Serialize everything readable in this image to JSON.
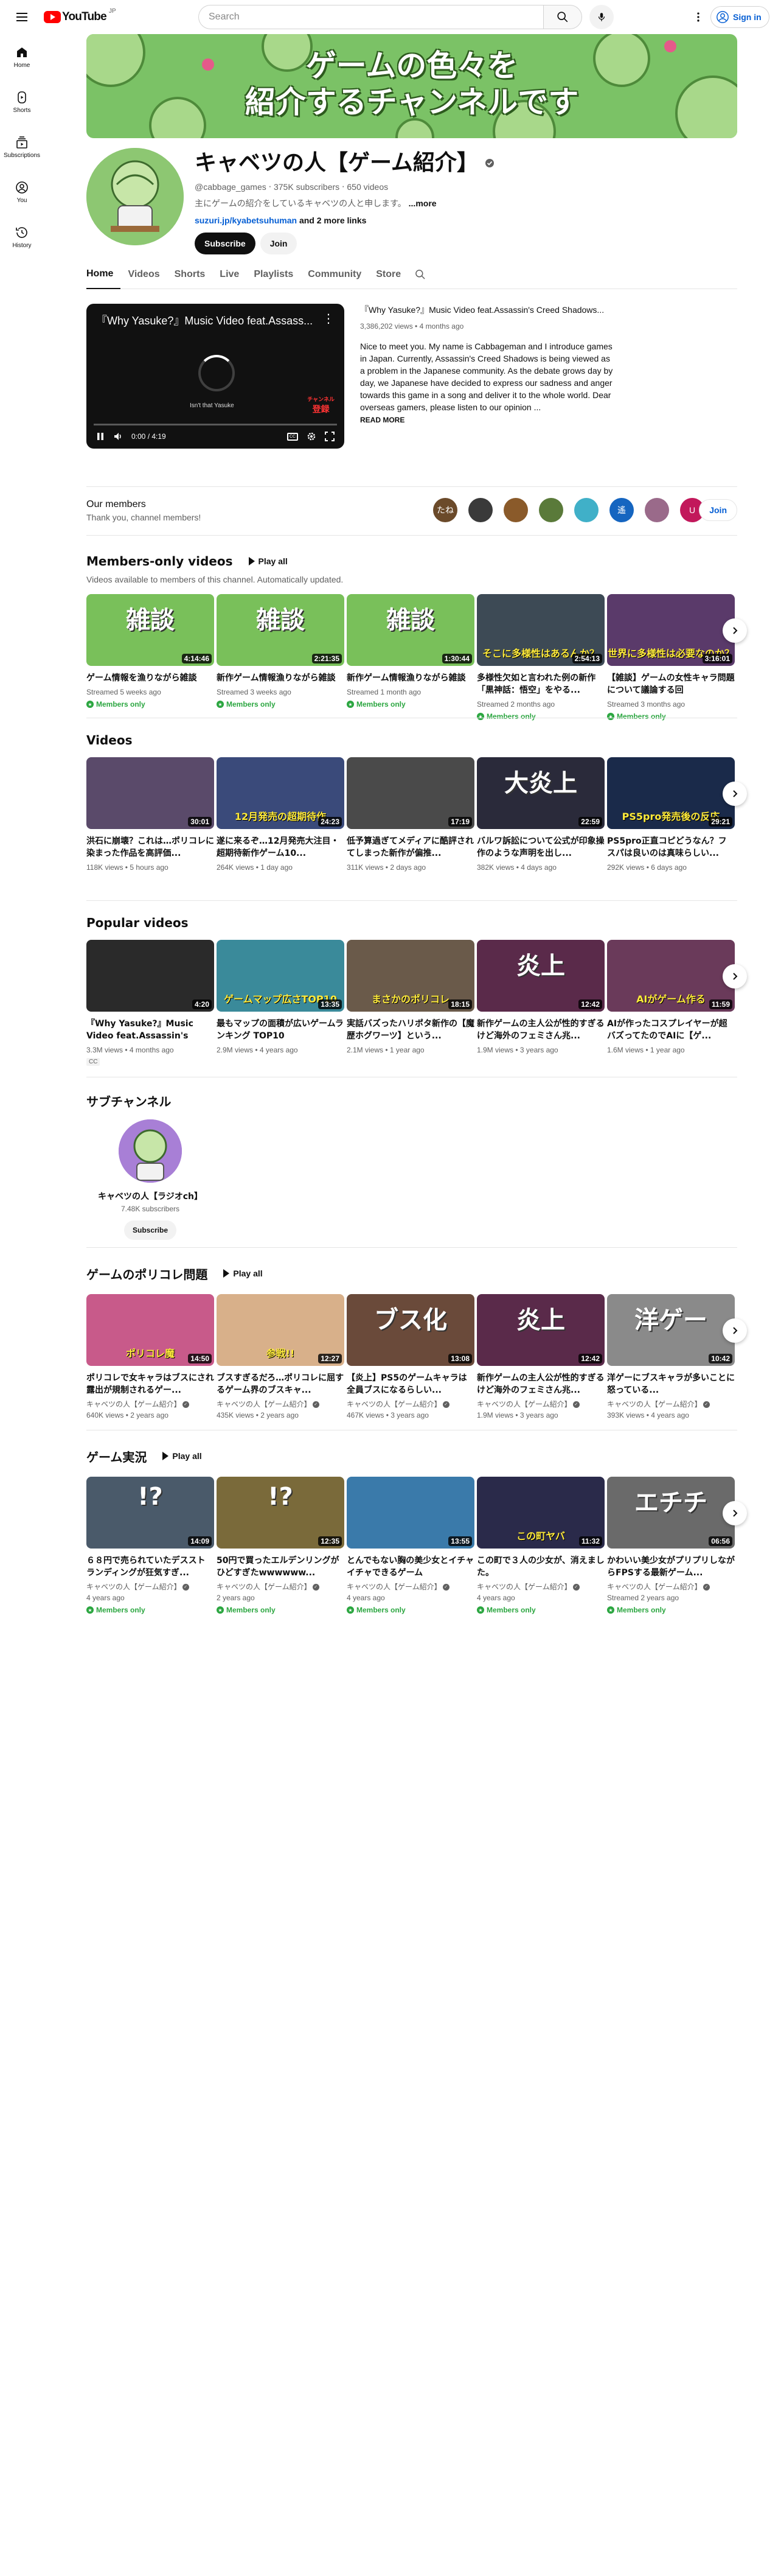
{
  "topbar": {
    "logo_text": "YouTube",
    "logo_region": "JP",
    "search_placeholder": "Search",
    "signin_label": "Sign in"
  },
  "guide": [
    {
      "label": "Home",
      "icon": "home-icon"
    },
    {
      "label": "Shorts",
      "icon": "shorts-icon"
    },
    {
      "label": "Subscriptions",
      "icon": "subscriptions-icon"
    },
    {
      "label": "You",
      "icon": "you-icon"
    },
    {
      "label": "History",
      "icon": "history-icon"
    }
  ],
  "banner": {
    "line1": "ゲームの色々を",
    "line2": "紹介するチャンネルです",
    "bg": "#7bc266"
  },
  "channel": {
    "name": "キャベツの人【ゲーム紹介】",
    "handle": "@cabbage_games",
    "subscribers": "375K subscribers",
    "videos": "650 videos",
    "description": "主にゲームの紹介をしているキャベツの人と申します。",
    "more": "...more",
    "link": "suzuri.jp/kyabetsuhuman",
    "link_more": "and 2 more links",
    "subscribe": "Subscribe",
    "join": "Join"
  },
  "tabs": [
    "Home",
    "Videos",
    "Shorts",
    "Live",
    "Playlists",
    "Community",
    "Store"
  ],
  "featured": {
    "player_title": "『Why Yasuke?』Music Video feat.Assass...",
    "player_caption": "Isn't that Yasuke",
    "player_sub_line1": "チャンネル",
    "player_sub_line2": "登録",
    "time": "0:00 / 4:19",
    "title": "『Why Yasuke?』Music Video feat.Assassin's Creed Shadows...",
    "meta": "3,386,202 views • 4 months ago",
    "description": "Nice to meet you. My name is Cabbageman and I introduce games in Japan. Currently, Assassin's Creed Shadows is being viewed as a problem in the Japanese community. As the debate grows day by day, we Japanese have decided to express our sadness and anger towards this game in a song and deliver it to the whole world. Dear overseas gamers, please listen to our opinion ...",
    "read_more": "READ MORE"
  },
  "members": {
    "title": "Our members",
    "subtitle": "Thank you, channel members!",
    "avatars": [
      {
        "label": "たね",
        "color": "#6b4a2a"
      },
      {
        "label": "",
        "color": "#3a3a3a"
      },
      {
        "label": "",
        "color": "#8a5a2a"
      },
      {
        "label": "",
        "color": "#5a7a3a"
      },
      {
        "label": "",
        "color": "#40b0c8"
      },
      {
        "label": "遙",
        "color": "#1565c0"
      },
      {
        "label": "",
        "color": "#9a6a8a"
      },
      {
        "label": "U",
        "color": "#c2185b"
      }
    ],
    "join": "Join"
  },
  "sections": {
    "members_only": {
      "title": "Members-only videos",
      "play_all": "Play all",
      "subtitle": "Videos available to members of this channel. Automatically updated.",
      "badge": "Members only",
      "items": [
        {
          "thumb": "雑談",
          "bg": "#79c05a",
          "dur": "4:14:46",
          "title": "ゲーム情報を漁りながら雑談",
          "meta": "Streamed 5 weeks ago"
        },
        {
          "thumb": "雑談",
          "bg": "#79c05a",
          "dur": "2:21:35",
          "title": "新作ゲーム情報漁りながら雑談",
          "meta": "Streamed 3 weeks ago"
        },
        {
          "thumb": "雑談",
          "bg": "#79c05a",
          "dur": "1:30:44",
          "title": "新作ゲーム情報漁りながら雑談",
          "meta": "Streamed 1 month ago"
        },
        {
          "thumb": "そこに多様性はあるんか？",
          "bg": "#3d4a55",
          "dur": "2:54:13",
          "title": "多様性欠如と言われた例の新作「黒神話：悟空」をやる...",
          "meta": "Streamed 2 months ago"
        },
        {
          "thumb": "世界に多様性は必要なのか？",
          "bg": "#5a3a6a",
          "dur": "3:16:01",
          "title": "【雑談】ゲームの女性キャラ問題について議論する回",
          "meta": "Streamed 3 months ago"
        }
      ]
    },
    "videos": {
      "title": "Videos",
      "items": [
        {
          "thumb": "",
          "bg": "#5a4a6a",
          "dur": "30:01",
          "title": "洪石に崩壊？これは…ポリコレに染まった作品を高評価...",
          "meta": "118K views • 5 hours ago"
        },
        {
          "thumb": "12月発売の超期待作",
          "bg": "#3a4a7a",
          "dur": "24:23",
          "title": "遂に来るぞ…12月発売大注目・超期待新作ゲーム10...",
          "meta": "264K views • 1 day ago"
        },
        {
          "thumb": "",
          "bg": "#4a4a4a",
          "dur": "17:19",
          "title": "低予算過ぎてメディアに酷評されてしまった新作が偏推...",
          "meta": "311K views • 2 days ago"
        },
        {
          "thumb": "大炎上",
          "bg": "#2a2a3a",
          "dur": "22:59",
          "title": "バルワ訴訟について公式が印象操作のような声明を出し...",
          "meta": "382K views • 4 days ago"
        },
        {
          "thumb": "PS5pro発売後の反応",
          "bg": "#1a2a4a",
          "dur": "29:21",
          "title": "PS5pro正直コピどうなん？フスパは良いのは真味らしい...",
          "meta": "292K views • 6 days ago"
        }
      ]
    },
    "popular": {
      "title": "Popular videos",
      "items": [
        {
          "thumb": "",
          "bg": "#2a2a2a",
          "dur": "4:20",
          "title": "『Why Yasuke?』Music Video feat.Assassin's Creed Shadows",
          "meta": "3.3M views • 4 months ago",
          "cc": "CC"
        },
        {
          "thumb": "ゲームマップ広さTOP10",
          "bg": "#3a8a9a",
          "dur": "13:35",
          "title": "最もマップの面積が広いゲームランキング TOP10",
          "meta": "2.9M views • 4 years ago"
        },
        {
          "thumb": "まさかのポリコレ",
          "bg": "#6a5a4a",
          "dur": "18:15",
          "title": "実話バズったハリポタ新作の【魔歴ホグワーツ】という...",
          "meta": "2.1M views • 1 year ago"
        },
        {
          "thumb": "炎上",
          "bg": "#5a2a4a",
          "dur": "12:42",
          "title": "新作ゲームの主人公が性的すぎるけど海外のフェミさん兆...",
          "meta": "1.9M views • 3 years ago"
        },
        {
          "thumb": "AIがゲーム作る",
          "bg": "#6a3a5a",
          "dur": "11:59",
          "title": "AIが作ったコスプレイヤーが超バズってたのでAIに【ゲ...",
          "meta": "1.6M views • 1 year ago"
        }
      ]
    },
    "subchannels": {
      "title": "サブチャンネル",
      "name": "キャベツの人【ラジオch】",
      "subs": "7.48K subscribers",
      "subscribe": "Subscribe"
    },
    "policorre": {
      "title": "ゲームのポリコレ問題",
      "play_all": "Play all",
      "channel": "キャベツの人【ゲーム紹介】",
      "items": [
        {
          "thumb": "ポリコレ魔",
          "bg": "#c85a8a",
          "dur": "14:50",
          "title": "ポリコレで女キャラはブスにされ露出が規制されるゲー...",
          "meta": "640K views • 2 years ago"
        },
        {
          "thumb": "参戦!!",
          "bg": "#d8b08a",
          "dur": "12:27",
          "title": "ブスすぎるだろ…ポリコレに屈するゲーム界のブスキャ...",
          "meta": "435K views • 2 years ago"
        },
        {
          "thumb": "ブス化",
          "bg": "#6a4a3a",
          "dur": "13:08",
          "title": "【炎上】PS5のゲームキャラは全員ブスになるらしい...",
          "meta": "467K views • 3 years ago"
        },
        {
          "thumb": "炎上",
          "bg": "#5a2a4a",
          "dur": "12:42",
          "title": "新作ゲームの主人公が性的すぎるけど海外のフェミさん兆...",
          "meta": "1.9M views • 3 years ago"
        },
        {
          "thumb": "洋ゲー",
          "bg": "#8a8a8a",
          "dur": "10:42",
          "title": "洋ゲーにブスキャラが多いことに怒っている...",
          "meta": "393K views • 4 years ago"
        }
      ]
    },
    "gameplay": {
      "title": "ゲーム実況",
      "play_all": "Play all",
      "channel": "キャベツの人【ゲーム紹介】",
      "badge": "Members only",
      "items": [
        {
          "thumb": "!?",
          "bg": "#4a5a6a",
          "dur": "14:09",
          "title": "６８円で売られていたデススト ランディングが狂気すぎ...",
          "meta": "4 years ago"
        },
        {
          "thumb": "!?",
          "bg": "#7a6a3a",
          "dur": "12:35",
          "title": "50円で買ったエルデンリングがひどすぎたwwwwww...",
          "meta": "2 years ago"
        },
        {
          "thumb": "",
          "bg": "#3a7aaa",
          "dur": "13:55",
          "title": "とんでもない胸の美少女とイチャイチャできるゲーム",
          "meta": "4 years ago"
        },
        {
          "thumb": "この町ヤバ",
          "bg": "#2a2a4a",
          "dur": "11:32",
          "title": "この町で３人の少女が、消えました。",
          "meta": "4 years ago"
        },
        {
          "thumb": "エチチ",
          "bg": "#6a6a6a",
          "dur": "06:56",
          "title": "かわいい美少女がプリプリしながらFPSする最新ゲーム...",
          "meta": "Streamed 2 years ago"
        }
      ]
    }
  },
  "colors": {
    "accent": "#ff0000",
    "link": "#065fd4",
    "members_badge": "#2ba640"
  }
}
